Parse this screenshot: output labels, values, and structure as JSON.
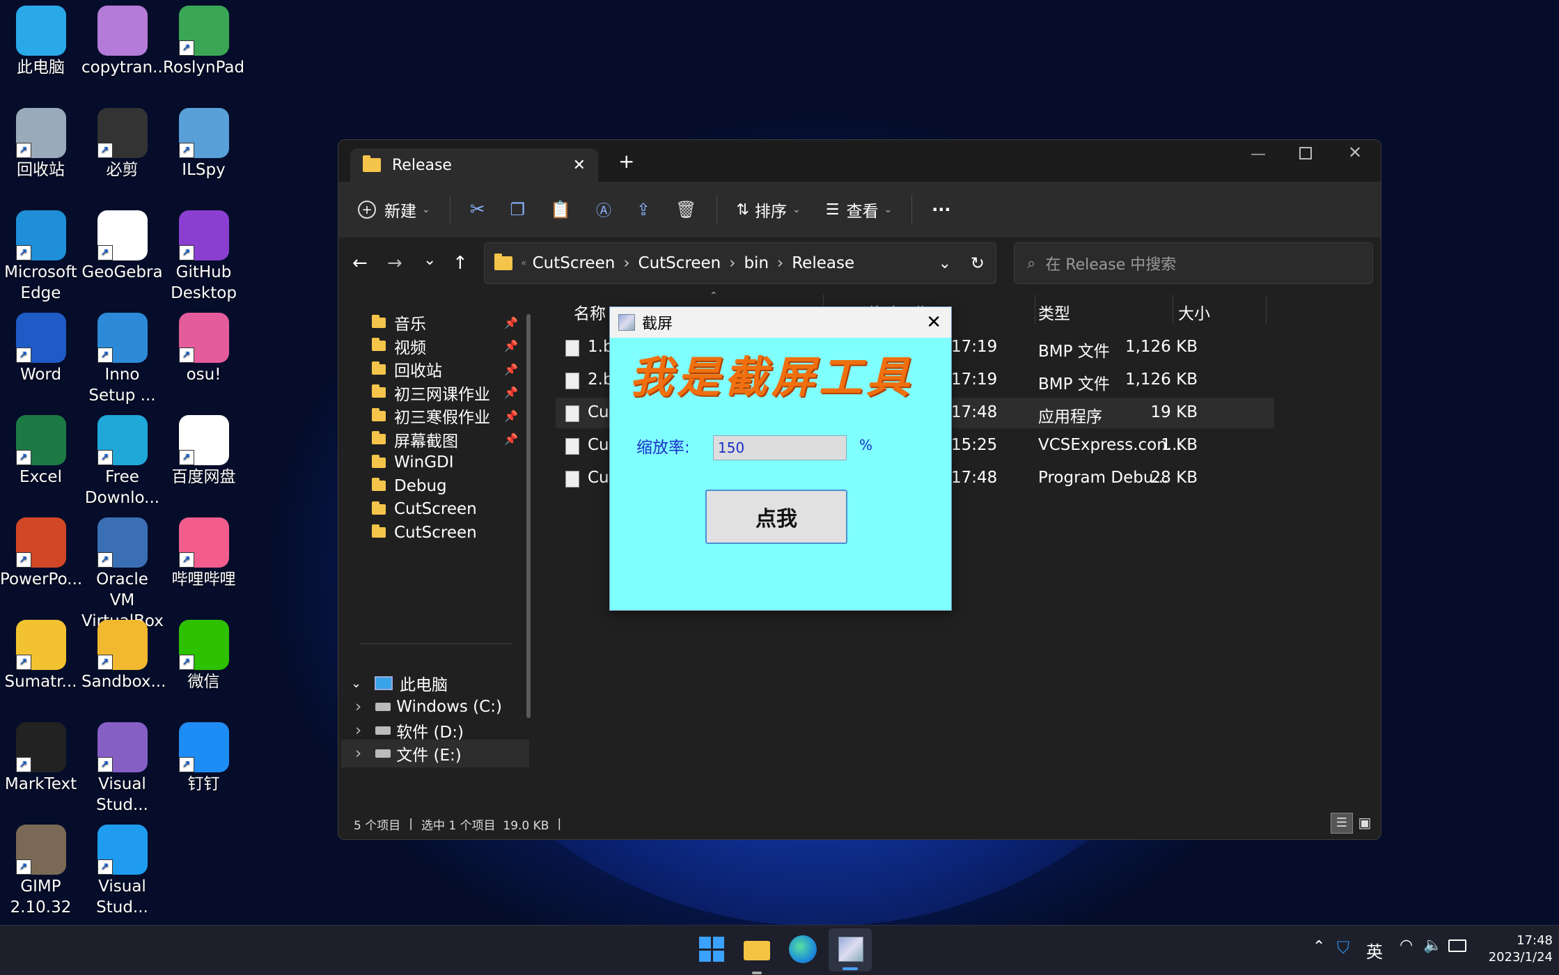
{
  "desktop": {
    "icons": [
      {
        "label": "此电脑",
        "icon": "computer-icon",
        "color": "#29a9e8"
      },
      {
        "label": "copytran...",
        "icon": "copytranslator-icon",
        "color": "#b57bd8"
      },
      {
        "label": "RoslynPad",
        "icon": "roslynpad-icon",
        "color": "#3aa655"
      },
      {
        "label": "回收站",
        "icon": "recycle-bin-icon",
        "color": "#9ab"
      },
      {
        "label": "必剪",
        "icon": "bijian-icon",
        "color": "#333"
      },
      {
        "label": "ILSpy",
        "icon": "ilspy-icon",
        "color": "#5aa0d8"
      },
      {
        "label": "Microsoft Edge",
        "icon": "edge-icon",
        "color": "#1e8fd8"
      },
      {
        "label": "GeoGebra",
        "icon": "geogebra-icon",
        "color": "#fff"
      },
      {
        "label": "GitHub Desktop",
        "icon": "github-desktop-icon",
        "color": "#8b3fd0"
      },
      {
        "label": "Word",
        "icon": "word-icon",
        "color": "#1e5bc6"
      },
      {
        "label": "Inno Setup ...",
        "icon": "inno-setup-icon",
        "color": "#2c8ad8"
      },
      {
        "label": "osu!",
        "icon": "osu-icon",
        "color": "#e45c9b"
      },
      {
        "label": "Excel",
        "icon": "excel-icon",
        "color": "#1d7a45"
      },
      {
        "label": "Free Downlo...",
        "icon": "free-download-icon",
        "color": "#20a8d8"
      },
      {
        "label": "百度网盘",
        "icon": "baidu-netdisk-icon",
        "color": "#fff"
      },
      {
        "label": "PowerPo...",
        "icon": "powerpoint-icon",
        "color": "#d24726"
      },
      {
        "label": "Oracle VM VirtualBox",
        "icon": "virtualbox-icon",
        "color": "#3b6fb5"
      },
      {
        "label": "哔哩哔哩",
        "icon": "bilibili-icon",
        "color": "#f25d8e"
      },
      {
        "label": "Sumatr...",
        "icon": "sumatra-pdf-icon",
        "color": "#f2c230"
      },
      {
        "label": "Sandbox...",
        "icon": "sandboxie-icon",
        "color": "#f2b830"
      },
      {
        "label": "微信",
        "icon": "wechat-icon",
        "color": "#2dc100"
      },
      {
        "label": "MarkText",
        "icon": "marktext-icon",
        "color": "#222"
      },
      {
        "label": "Visual Stud...",
        "icon": "visual-studio-icon",
        "color": "#865fc5"
      },
      {
        "label": "钉钉",
        "icon": "dingtalk-icon",
        "color": "#1e8cf5"
      },
      {
        "label": "GIMP 2.10.32",
        "icon": "gimp-icon",
        "color": "#7a6a55"
      },
      {
        "label": "Visual Stud...",
        "icon": "vscode-icon",
        "color": "#1f9cf0"
      }
    ]
  },
  "explorer": {
    "tab_title": "Release",
    "toolbar": {
      "new_label": "新建",
      "sort_label": "排序",
      "view_label": "查看",
      "more_label": "···"
    },
    "breadcrumb": [
      "CutScreen",
      "CutScreen",
      "bin",
      "Release"
    ],
    "search_placeholder": "在 Release 中搜索",
    "nav_items": [
      {
        "label": "音乐",
        "pinned": true
      },
      {
        "label": "视频",
        "pinned": true
      },
      {
        "label": "回收站",
        "pinned": true
      },
      {
        "label": "初三网课作业",
        "pinned": true
      },
      {
        "label": "初三寒假作业",
        "pinned": true
      },
      {
        "label": "屏幕截图",
        "pinned": true
      },
      {
        "label": "WinGDI",
        "pinned": false
      },
      {
        "label": "Debug",
        "pinned": false
      },
      {
        "label": "CutScreen",
        "pinned": false
      },
      {
        "label": "CutScreen",
        "pinned": false
      }
    ],
    "this_pc": "此电脑",
    "drives": [
      "Windows (C:)",
      "软件 (D:)",
      "文件 (E:)"
    ],
    "columns": {
      "name": "名称",
      "modified": "修改日期",
      "type": "类型",
      "size": "大小"
    },
    "files": [
      {
        "name": "1.bmp",
        "name_visible": "1.br",
        "time": "17:19",
        "type": "BMP 文件",
        "size": "1,126 KB"
      },
      {
        "name": "2.bmp",
        "name_visible": "2.br",
        "time": "17:19",
        "type": "BMP 文件",
        "size": "1,126 KB"
      },
      {
        "name_visible": "Cut",
        "time": "17:48",
        "type": "应用程序",
        "size": "19 KB",
        "selected": true
      },
      {
        "name_visible": "Cut",
        "time": "15:25",
        "type": "VCSExpress.con...",
        "size": "1 KB"
      },
      {
        "name_visible": "Cut",
        "time": "17:48",
        "type": "Program Debu...",
        "size": "28 KB"
      }
    ],
    "status": {
      "count": "5 个项目",
      "selection": "选中 1 个项目  19.0 KB"
    }
  },
  "dialog": {
    "title": "截屏",
    "heading": "我是截屏工具",
    "scale_label": "缩放率:",
    "scale_value": "150",
    "percent": "%",
    "button_label": "点我"
  },
  "taskbar": {
    "tray_language": "英",
    "time": "17:48",
    "date": "2023/1/24"
  }
}
